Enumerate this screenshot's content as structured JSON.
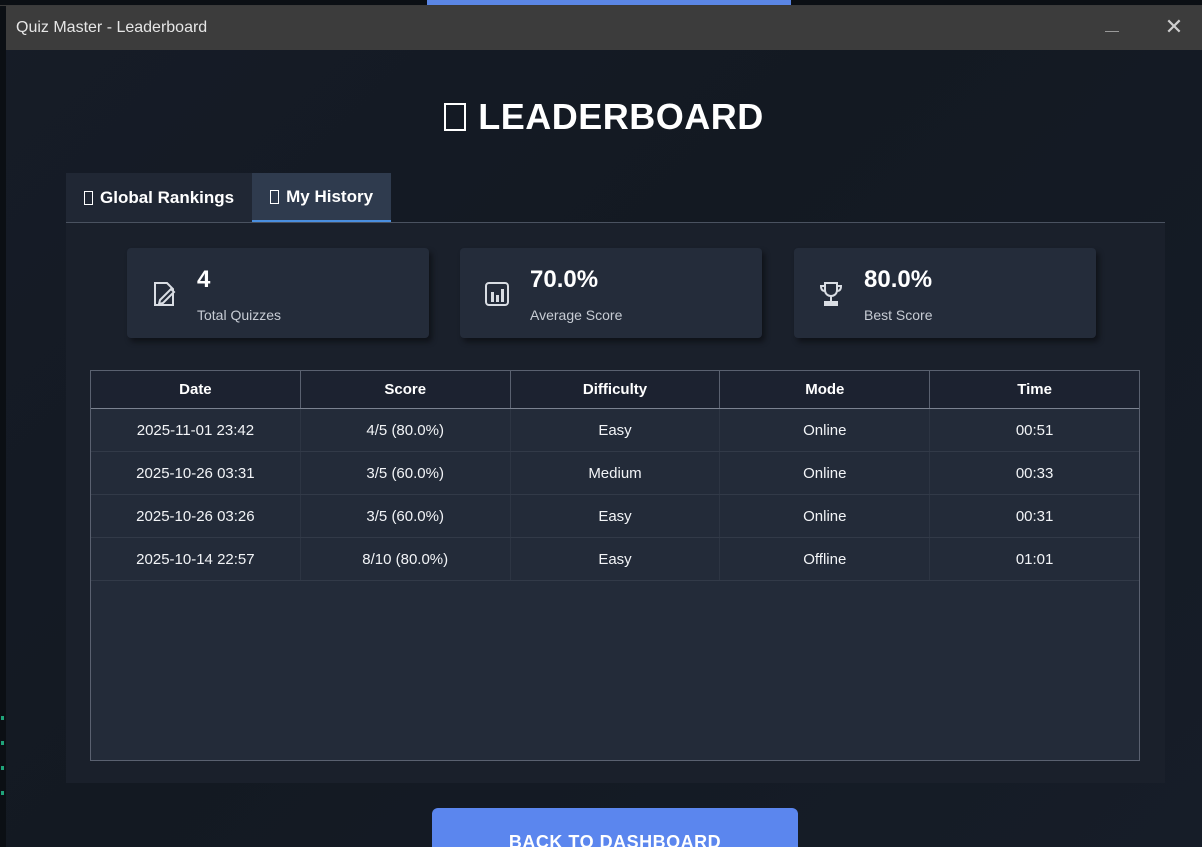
{
  "window": {
    "title": "Quiz Master - Leaderboard",
    "close_glyph": "✕"
  },
  "page": {
    "heading": "LEADERBOARD",
    "heading_icon": "trophy-icon"
  },
  "tabs": [
    {
      "label": "Global Rankings",
      "icon": "globe-icon",
      "active": false
    },
    {
      "label": "My History",
      "icon": "history-icon",
      "active": true
    }
  ],
  "stats": [
    {
      "value": "4",
      "label": "Total Quizzes",
      "icon": "edit-note-icon"
    },
    {
      "value": "70.0%",
      "label": "Average Score",
      "icon": "bar-chart-icon"
    },
    {
      "value": "80.0%",
      "label": "Best Score",
      "icon": "trophy-icon"
    }
  ],
  "history_table": {
    "columns": [
      "Date",
      "Score",
      "Difficulty",
      "Mode",
      "Time"
    ],
    "rows": [
      [
        "2025-11-01 23:42",
        "4/5 (80.0%)",
        "Easy",
        "Online",
        "00:51"
      ],
      [
        "2025-10-26 03:31",
        "3/5 (60.0%)",
        "Medium",
        "Online",
        "00:33"
      ],
      [
        "2025-10-26 03:26",
        "3/5 (60.0%)",
        "Easy",
        "Online",
        "00:31"
      ],
      [
        "2025-10-14 22:57",
        "8/10 (80.0%)",
        "Easy",
        "Offline",
        "01:01"
      ]
    ]
  },
  "back_button": {
    "label": "BACK TO DASHBOARD"
  },
  "colors": {
    "accent": "#5b86ee",
    "tab_underline": "#4a8fe0",
    "card": "#242c3a",
    "background": "#131922"
  }
}
